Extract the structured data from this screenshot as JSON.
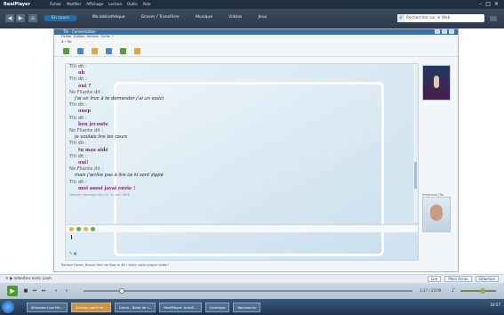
{
  "player": {
    "app_name": "RealPlayer",
    "top_menu": [
      "Fichier",
      "Modifier",
      "Affichage",
      "Lecture",
      "Outils",
      "Aide"
    ],
    "nav_tabs": [
      {
        "label": "En cours",
        "active": true
      },
      {
        "label": "Ma bibliothèque",
        "active": false
      },
      {
        "label": "Graver / Transférer",
        "active": false
      },
      {
        "label": "Musique",
        "active": false
      },
      {
        "label": "Vidéos",
        "active": false
      },
      {
        "label": "Jeux",
        "active": false
      }
    ],
    "search_placeholder": "Rechercher sur le Web",
    "now_playing": "✕ ▶ arbeiten avec Liam",
    "view_options": [
      "Lire",
      "Plein écran",
      "Sélection"
    ],
    "time": "1:37 / 23:09",
    "accent": "#1f6ca6",
    "play_color": "#4f9a2e"
  },
  "msn": {
    "title": "Titi - Conversation",
    "menu": [
      "Fichier",
      "Edition",
      "Actions",
      "Outils",
      "?"
    ],
    "to_line": "À : Titi",
    "messages": [
      {
        "speaker": "Titi dit :",
        "text": "oh",
        "style": "a"
      },
      {
        "speaker": "Titi dit :",
        "text": "oui ?",
        "style": "a"
      },
      {
        "speaker": "No Fliante dit :",
        "text": "j'ai un truc à te demander j'ai un souci",
        "style": "b"
      },
      {
        "speaker": "Titi dit :",
        "text": "ouep",
        "style": "a"
      },
      {
        "speaker": "Titi dit :",
        "text": "ben jecoute",
        "style": "a"
      },
      {
        "speaker": "No Fliante dit :",
        "text": "je voulais lire les cours",
        "style": "b"
      },
      {
        "speaker": "Titi dit :",
        "text": "tu mas aidé",
        "style": "a"
      },
      {
        "speaker": "Titi dit :",
        "text": "oui!",
        "style": "a"
      },
      {
        "speaker": "No Fliante dit :",
        "text": "mais j'arrive pas à lire ce ki sont zippé",
        "style": "b"
      },
      {
        "speaker": "Titi dit :",
        "text": "moi aussi javai envie !",
        "style": "a"
      }
    ],
    "last_message": "Dernier message reçu le 10 mai 2008",
    "side_label": "Ambroise (No Frontières)",
    "status_line": "Pensée Haute, Bonne Rien de Bonne 46 ! Votre votre propre vidéo !"
  },
  "taskbar": {
    "items": [
      {
        "label": "Windows Live Me...",
        "active": false
      },
      {
        "label": "Scribus point de...",
        "active": true
      },
      {
        "label": "Gmail - Boîte de r...",
        "active": false
      },
      {
        "label": "RealPlayer: arbeit...",
        "active": false
      },
      {
        "label": "Camtasia",
        "active": false
      },
      {
        "label": "Raccourcis",
        "active": false
      }
    ],
    "clock": "16:57"
  }
}
